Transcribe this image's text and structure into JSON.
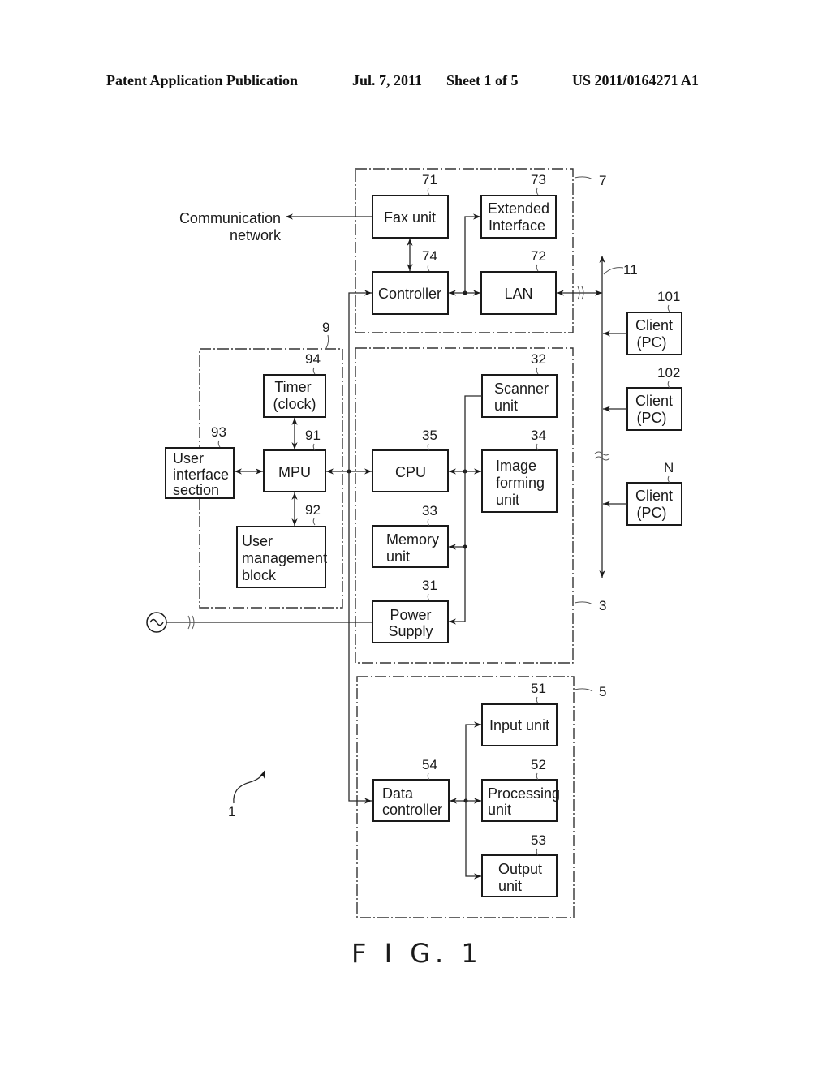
{
  "header": {
    "publication": "Patent Application Publication",
    "date": "Jul. 7, 2011",
    "sheet": "Sheet 1 of 5",
    "number": "US 2011/0164271 A1"
  },
  "figure": {
    "caption": "F I G. 1",
    "system_ref": "1",
    "bus_ref": "11",
    "external": {
      "comm_network_line1": "Communication",
      "comm_network_line2": "network"
    },
    "groups": {
      "g7": {
        "ref": "7"
      },
      "g9": {
        "ref": "9"
      },
      "g3": {
        "ref": "3"
      },
      "g5": {
        "ref": "5"
      }
    },
    "blocks": {
      "fax": {
        "ref": "71",
        "line1": "Fax unit"
      },
      "extif": {
        "ref": "73",
        "line1": "Extended",
        "line2": "Interface"
      },
      "controller": {
        "ref": "74",
        "line1": "Controller"
      },
      "lan": {
        "ref": "72",
        "line1": "LAN"
      },
      "timer": {
        "ref": "94",
        "line1": "Timer",
        "line2": "(clock)"
      },
      "ui": {
        "ref": "93",
        "line1": "User",
        "line2": "interface",
        "line3": "section"
      },
      "mpu": {
        "ref": "91",
        "line1": "MPU"
      },
      "usermgmt": {
        "ref": "92",
        "line1": "User",
        "line2": "management",
        "line3": "block"
      },
      "scanner": {
        "ref": "32",
        "line1": "Scanner",
        "line2": "unit"
      },
      "cpu": {
        "ref": "35",
        "line1": "CPU"
      },
      "imgform": {
        "ref": "34",
        "line1": "Image",
        "line2": "forming",
        "line3": "unit"
      },
      "memory": {
        "ref": "33",
        "line1": "Memory",
        "line2": "unit"
      },
      "power": {
        "ref": "31",
        "line1": "Power",
        "line2": "Supply"
      },
      "datactl": {
        "ref": "54",
        "line1": "Data",
        "line2": "controller"
      },
      "input": {
        "ref": "51",
        "line1": "Input unit"
      },
      "processing": {
        "ref": "52",
        "line1": "Processing",
        "line2": "unit"
      },
      "output": {
        "ref": "53",
        "line1": "Output",
        "line2": "unit"
      },
      "client1": {
        "ref": "101",
        "line1": "Client",
        "line2": "(PC)"
      },
      "client2": {
        "ref": "102",
        "line1": "Client",
        "line2": "(PC)"
      },
      "clientN": {
        "ref": "N",
        "line1": "Client",
        "line2": "(PC)"
      }
    }
  }
}
